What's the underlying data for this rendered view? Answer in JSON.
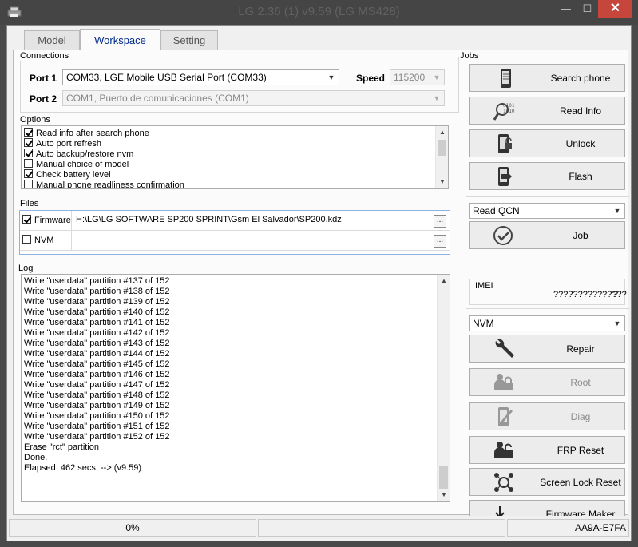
{
  "window": {
    "title": "LG 2.36 (1) v9.59 (LG MS428)",
    "minimize": "—",
    "maximize": "☐",
    "close": "✕"
  },
  "tabs": [
    "Model",
    "Workspace",
    "Setting"
  ],
  "connections": {
    "title": "Connections",
    "port1_label": "Port 1",
    "port1_value": "COM33, LGE Mobile USB Serial Port (COM33)",
    "speed_label": "Speed",
    "speed_value": "115200",
    "port2_label": "Port 2",
    "port2_value": "COM1, Puerto de comunicaciones (COM1)"
  },
  "options": {
    "title": "Options",
    "items": [
      {
        "label": "Read info after search phone",
        "checked": true
      },
      {
        "label": "Auto port refresh",
        "checked": true
      },
      {
        "label": "Auto backup/restore nvm",
        "checked": true
      },
      {
        "label": "Manual choice of model",
        "checked": false
      },
      {
        "label": "Check battery level",
        "checked": true
      },
      {
        "label": "Manual phone readliness confirmation",
        "checked": false
      }
    ]
  },
  "files": {
    "title": "Files",
    "rows": [
      {
        "label": "Firmware",
        "checked": true,
        "path": "H:\\LG\\LG SOFTWARE SP200 SPRINT\\Gsm El Salvador\\SP200.kdz",
        "browse": "..."
      },
      {
        "label": "NVM",
        "checked": false,
        "path": "",
        "browse": "..."
      }
    ]
  },
  "log": {
    "title": "Log",
    "lines": [
      "Write \"userdata\" partition #137 of 152",
      "Write \"userdata\" partition #138 of 152",
      "Write \"userdata\" partition #139 of 152",
      "Write \"userdata\" partition #140 of 152",
      "Write \"userdata\" partition #141 of 152",
      "Write \"userdata\" partition #142 of 152",
      "Write \"userdata\" partition #143 of 152",
      "Write \"userdata\" partition #144 of 152",
      "Write \"userdata\" partition #145 of 152",
      "Write \"userdata\" partition #146 of 152",
      "Write \"userdata\" partition #147 of 152",
      "Write \"userdata\" partition #148 of 152",
      "Write \"userdata\" partition #149 of 152",
      "Write \"userdata\" partition #150 of 152",
      "Write \"userdata\" partition #151 of 152",
      "Write \"userdata\" partition #152 of 152",
      "Erase \"rct\" partition",
      "Done.",
      "Elapsed: 462 secs. --> (v9.59)"
    ]
  },
  "jobs": {
    "title": "Jobs",
    "search_phone": "Search phone",
    "read_info": "Read Info",
    "unlock": "Unlock",
    "flash": "Flash",
    "qcn_select": "Read QCN",
    "job": "Job",
    "imei_label": "IMEI",
    "imei_value": "???????????????",
    "imei_help": "?",
    "nvm_select": "NVM",
    "repair": "Repair",
    "root": "Root",
    "diag": "Diag",
    "frp_reset": "FRP Reset",
    "screen_lock_reset": "Screen Lock Reset",
    "firmware_maker": "Firmware Maker"
  },
  "statusbar": {
    "progress": "0%",
    "middle": "",
    "code": "AA9A-E7FA"
  },
  "icons": {
    "app": "printer-icon",
    "search": "phone-search-icon",
    "read_info": "magnifier-binary-icon",
    "unlock": "phone-lock-icon",
    "flash": "phone-arrow-icon",
    "job": "checkmark-circle-icon",
    "repair": "wrench-icon",
    "root": "user-lock-icon",
    "diag": "phone-pen-icon",
    "frp": "user-unlock-icon",
    "screen_lock": "network-magnifier-icon",
    "firmware_maker": "download-arrow-icon"
  }
}
